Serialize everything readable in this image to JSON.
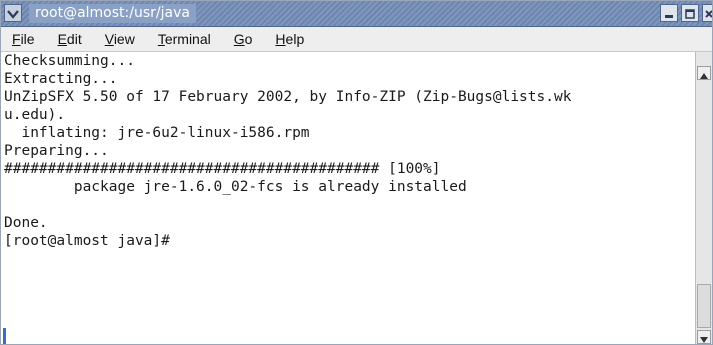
{
  "window": {
    "title": "root@almost:/usr/java"
  },
  "menubar": {
    "items": [
      {
        "accel": "F",
        "rest": "ile"
      },
      {
        "accel": "E",
        "rest": "dit"
      },
      {
        "accel": "V",
        "rest": "iew"
      },
      {
        "accel": "T",
        "rest": "erminal"
      },
      {
        "accel": "G",
        "rest": "o"
      },
      {
        "accel": "H",
        "rest": "elp"
      }
    ]
  },
  "terminal": {
    "lines": [
      "Checksumming...",
      "Extracting...",
      "UnZipSFX 5.50 of 17 February 2002, by Info-ZIP (Zip-Bugs@lists.wk",
      "u.edu).",
      "  inflating: jre-6u2-linux-i586.rpm",
      "Preparing...",
      "########################################### [100%]",
      "        package jre-1.6.0_02-fcs is already installed",
      "",
      "Done.",
      "[root@almost java]#"
    ]
  },
  "icons": {
    "window_menu": "chevron-down-icon",
    "minimize": "minimize-icon",
    "maximize": "maximize-icon",
    "close": "close-icon",
    "scroll_up": "arrow-up-icon",
    "scroll_down": "arrow-down-icon"
  }
}
